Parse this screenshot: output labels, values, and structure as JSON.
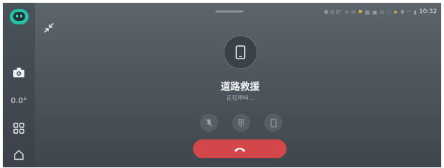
{
  "app": {
    "accent": "#23c2a7",
    "hangup_color": "#d3474a"
  },
  "sidebar": {
    "temperature": "0.0°",
    "items": [
      {
        "icon": "robot-assistant-icon"
      },
      {
        "icon": "camera-icon"
      },
      {
        "icon": "app-grid-icon"
      },
      {
        "icon": "home-icon"
      }
    ]
  },
  "status_bar": {
    "temperature": "0.0°",
    "time": "10:32"
  },
  "call": {
    "caller_name": "道路救援",
    "status": "正在呼叫..."
  }
}
